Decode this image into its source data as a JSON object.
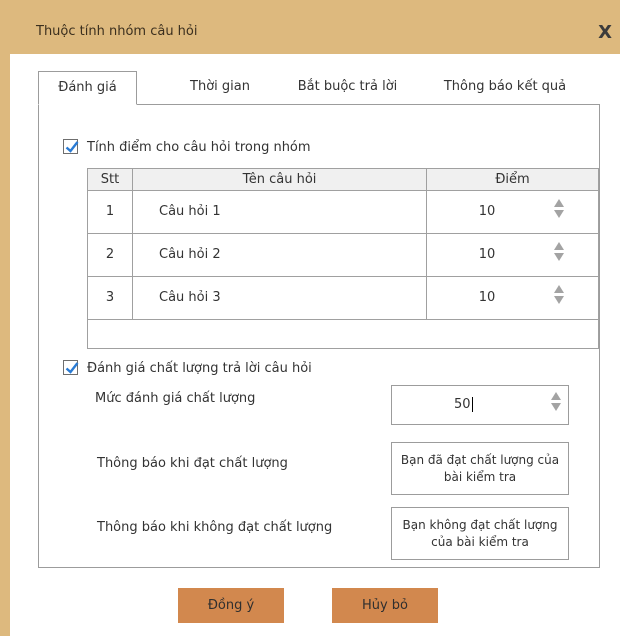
{
  "dialog": {
    "title": "Thuộc tính nhóm câu hỏi",
    "close_glyph": "X"
  },
  "tabs": [
    {
      "label": "Đánh giá",
      "active": true
    },
    {
      "label": "Thời gian",
      "active": false
    },
    {
      "label": "Bắt buộc trả lời",
      "active": false
    },
    {
      "label": "Thông báo kết quả",
      "active": false
    }
  ],
  "scoring": {
    "checkbox_label": "Tính điểm cho câu hỏi trong nhóm",
    "checked": true,
    "columns": {
      "index": "Stt",
      "question": "Tên câu hỏi",
      "score": "Điểm"
    },
    "rows": [
      {
        "index": "1",
        "question": "Câu hỏi 1",
        "score": "10"
      },
      {
        "index": "2",
        "question": "Câu hỏi 2",
        "score": "10"
      },
      {
        "index": "3",
        "question": "Câu hỏi 3",
        "score": "10"
      }
    ]
  },
  "quality": {
    "checkbox_label": "Đánh giá chất lượng trả lời câu hỏi",
    "checked": true,
    "level_label": "Mức đánh giá chất lượng",
    "level_value": "50",
    "pass_label": "Thông báo khi đạt chất lượng",
    "pass_message": "Bạn đã đạt chất lượng của bài kiểm tra",
    "fail_label": "Thông báo khi không đạt chất lượng",
    "fail_message": "Bạn không đạt chất lượng của bài kiểm tra"
  },
  "buttons": {
    "ok": "Đồng ý",
    "cancel": "Hủy bỏ"
  },
  "colors": {
    "title_bar": "#ddb97e",
    "button": "#d2884e",
    "check": "#2a7bd4"
  },
  "icons": {
    "close": "close-icon",
    "check": "checkmark-icon",
    "spin": "spinner-arrows-icon"
  }
}
